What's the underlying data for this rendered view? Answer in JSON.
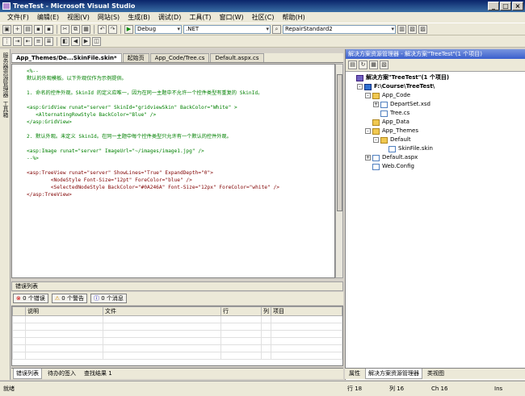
{
  "window": {
    "title": "TreeTest - Microsoft Visual Studio",
    "min": "_",
    "max": "□",
    "close": "×"
  },
  "menu": [
    "文件(F)",
    "编辑(E)",
    "视图(V)",
    "网站(S)",
    "生成(B)",
    "调试(D)",
    "工具(T)",
    "窗口(W)",
    "社区(C)",
    "帮助(H)"
  ],
  "toolbar": {
    "config": "Debug",
    "platform": ".NET",
    "search": "RepairStandard2"
  },
  "left_toolbox": {
    "label1": "服务器资源管理器",
    "label2": "工具箱"
  },
  "tabs": [
    "App_Themes/De...SkinFile.skin*",
    "起始页",
    "App_Code/Tree.cs",
    "Default.aspx.cs"
  ],
  "editor_lines": [
    {
      "c": "comment",
      "t": "<%--"
    },
    {
      "c": "comment",
      "t": "默认的外观模板。以下外观仅作为示例提供。"
    },
    {
      "c": "comment",
      "t": ""
    },
    {
      "c": "comment",
      "t": "1. 命名的控件外观。SkinId 的定义应唯一，因为在同一主题中不允许一个控件类型有重复的 SkinId。"
    },
    {
      "c": "comment",
      "t": ""
    },
    {
      "c": "comment",
      "t": "<asp:GridView runat=\"server\" SkinId=\"gridviewSkin\" BackColor=\"White\" >"
    },
    {
      "c": "comment",
      "t": "   <AlternatingRowStyle BackColor=\"Blue\" />"
    },
    {
      "c": "comment",
      "t": "</asp:GridView>"
    },
    {
      "c": "comment",
      "t": ""
    },
    {
      "c": "comment",
      "t": "2. 默认外观。未定义 SkinId。在同一主题中每个控件类型只允许有一个默认的控件外观。"
    },
    {
      "c": "comment",
      "t": ""
    },
    {
      "c": "comment",
      "t": "<asp:Image runat=\"server\" ImageUrl=\"~/images/image1.jpg\" />"
    },
    {
      "c": "comment",
      "t": "--%>"
    },
    {
      "c": "comment",
      "t": ""
    },
    {
      "c": "code",
      "t": "<asp:TreeView runat=\"server\" ShowLines=\"True\" ExpandDepth=\"0\">"
    },
    {
      "c": "code",
      "t": "        <NodeStyle Font-Size=\"12pt\" ForeColor=\"blue\" />"
    },
    {
      "c": "code",
      "t": "        <SelectedNodeStyle BackColor=\"#0A246A\" Font-Size=\"12px\" ForeColor=\"white\" />"
    },
    {
      "c": "code",
      "t": "</asp:TreeView>"
    }
  ],
  "errors": {
    "title": "错误列表",
    "errors_btn": "0 个错误",
    "warnings_btn": "0 个警告",
    "messages_btn": "0 个消息",
    "columns": [
      "",
      "说明",
      "文件",
      "行",
      "列",
      "项目"
    ]
  },
  "bottom_tabs": [
    "错误列表",
    "待办的签入",
    "查找结果 1"
  ],
  "solution": {
    "header": "解决方案资源管理器 - 解决方案\"TreeTest\"(1 个项目)",
    "nodes": [
      {
        "indent": 0,
        "exp": "",
        "icon": "sol",
        "label": "解决方案\"TreeTest\"(1 个项目)"
      },
      {
        "indent": 1,
        "exp": "-",
        "icon": "proj",
        "label": "F:\\Course\\TreeTest\\"
      },
      {
        "indent": 2,
        "exp": "-",
        "icon": "folder",
        "label": "App_Code"
      },
      {
        "indent": 3,
        "exp": "+",
        "icon": "file",
        "label": "DepartSet.xsd"
      },
      {
        "indent": 3,
        "exp": "",
        "icon": "file",
        "label": "Tree.cs"
      },
      {
        "indent": 2,
        "exp": "",
        "icon": "folder",
        "label": "App_Data"
      },
      {
        "indent": 2,
        "exp": "-",
        "icon": "folder",
        "label": "App_Themes"
      },
      {
        "indent": 3,
        "exp": "-",
        "icon": "folder",
        "label": "Default"
      },
      {
        "indent": 4,
        "exp": "",
        "icon": "file",
        "label": "SkinFile.skin"
      },
      {
        "indent": 2,
        "exp": "+",
        "icon": "file",
        "label": "Default.aspx"
      },
      {
        "indent": 2,
        "exp": "",
        "icon": "file",
        "label": "Web.Config"
      }
    ]
  },
  "right_bottom_tabs": [
    "属性",
    "解决方案资源管理器",
    "类视图"
  ],
  "status": {
    "ready": "就绪",
    "line": "行 18",
    "col": "列 16",
    "ch": "Ch 16",
    "ins": "Ins"
  }
}
